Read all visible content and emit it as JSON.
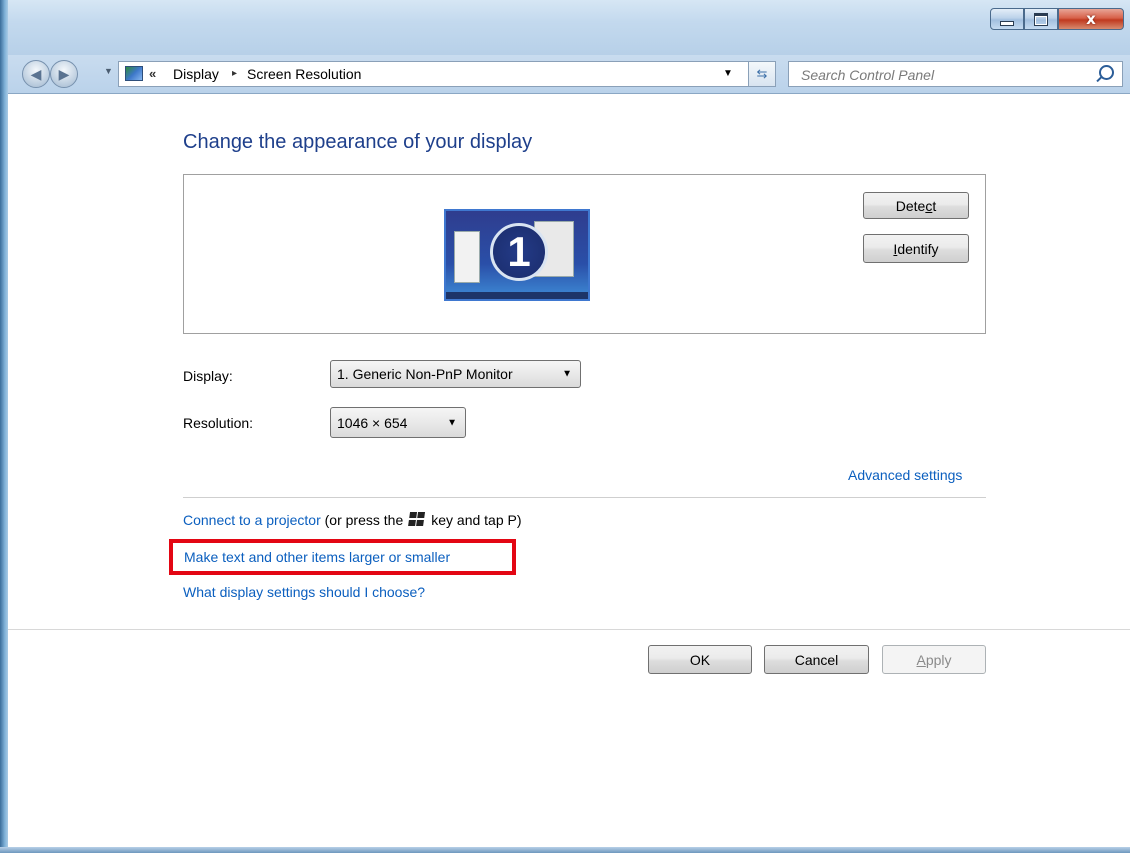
{
  "window": {
    "caption_buttons": {
      "minimize_icon": "minimize-icon",
      "maximize_icon": "maximize-icon",
      "close_glyph": "x"
    }
  },
  "nav": {
    "back_icon": "back-arrow-icon",
    "forward_icon": "forward-arrow-icon",
    "address_chevrons": "«",
    "breadcrumbs": [
      {
        "label": "Display"
      },
      {
        "label": "Screen Resolution"
      }
    ],
    "crumb_separator": "▸",
    "refresh_icon": "refresh-icon"
  },
  "search": {
    "placeholder": "Search Control Panel"
  },
  "main": {
    "title": "Change the appearance of your display",
    "monitor_number": "1",
    "detect_button": {
      "before": "Dete",
      "accel": "c",
      "after": "t"
    },
    "identify_button": {
      "accel": "I",
      "after": "dentify"
    },
    "display_label": "Display:",
    "display_value": "1. Generic Non-PnP Monitor",
    "resolution_label": "Resolution:",
    "resolution_value": "1046 × 654",
    "advanced_settings": "Advanced settings",
    "projector_link": "Connect to a projector",
    "projector_text_before": " (or press the",
    "projector_text_after": "key and tap P)",
    "text_size_link": "Make text and other items larger or smaller",
    "which_settings_link": "What display settings should I choose?"
  },
  "footer": {
    "ok": "OK",
    "cancel": "Cancel",
    "apply": {
      "accel": "A",
      "after": "pply"
    }
  },
  "colors": {
    "link": "#0b5fbf",
    "title": "#1e3f8b",
    "highlight": "#e30613"
  }
}
